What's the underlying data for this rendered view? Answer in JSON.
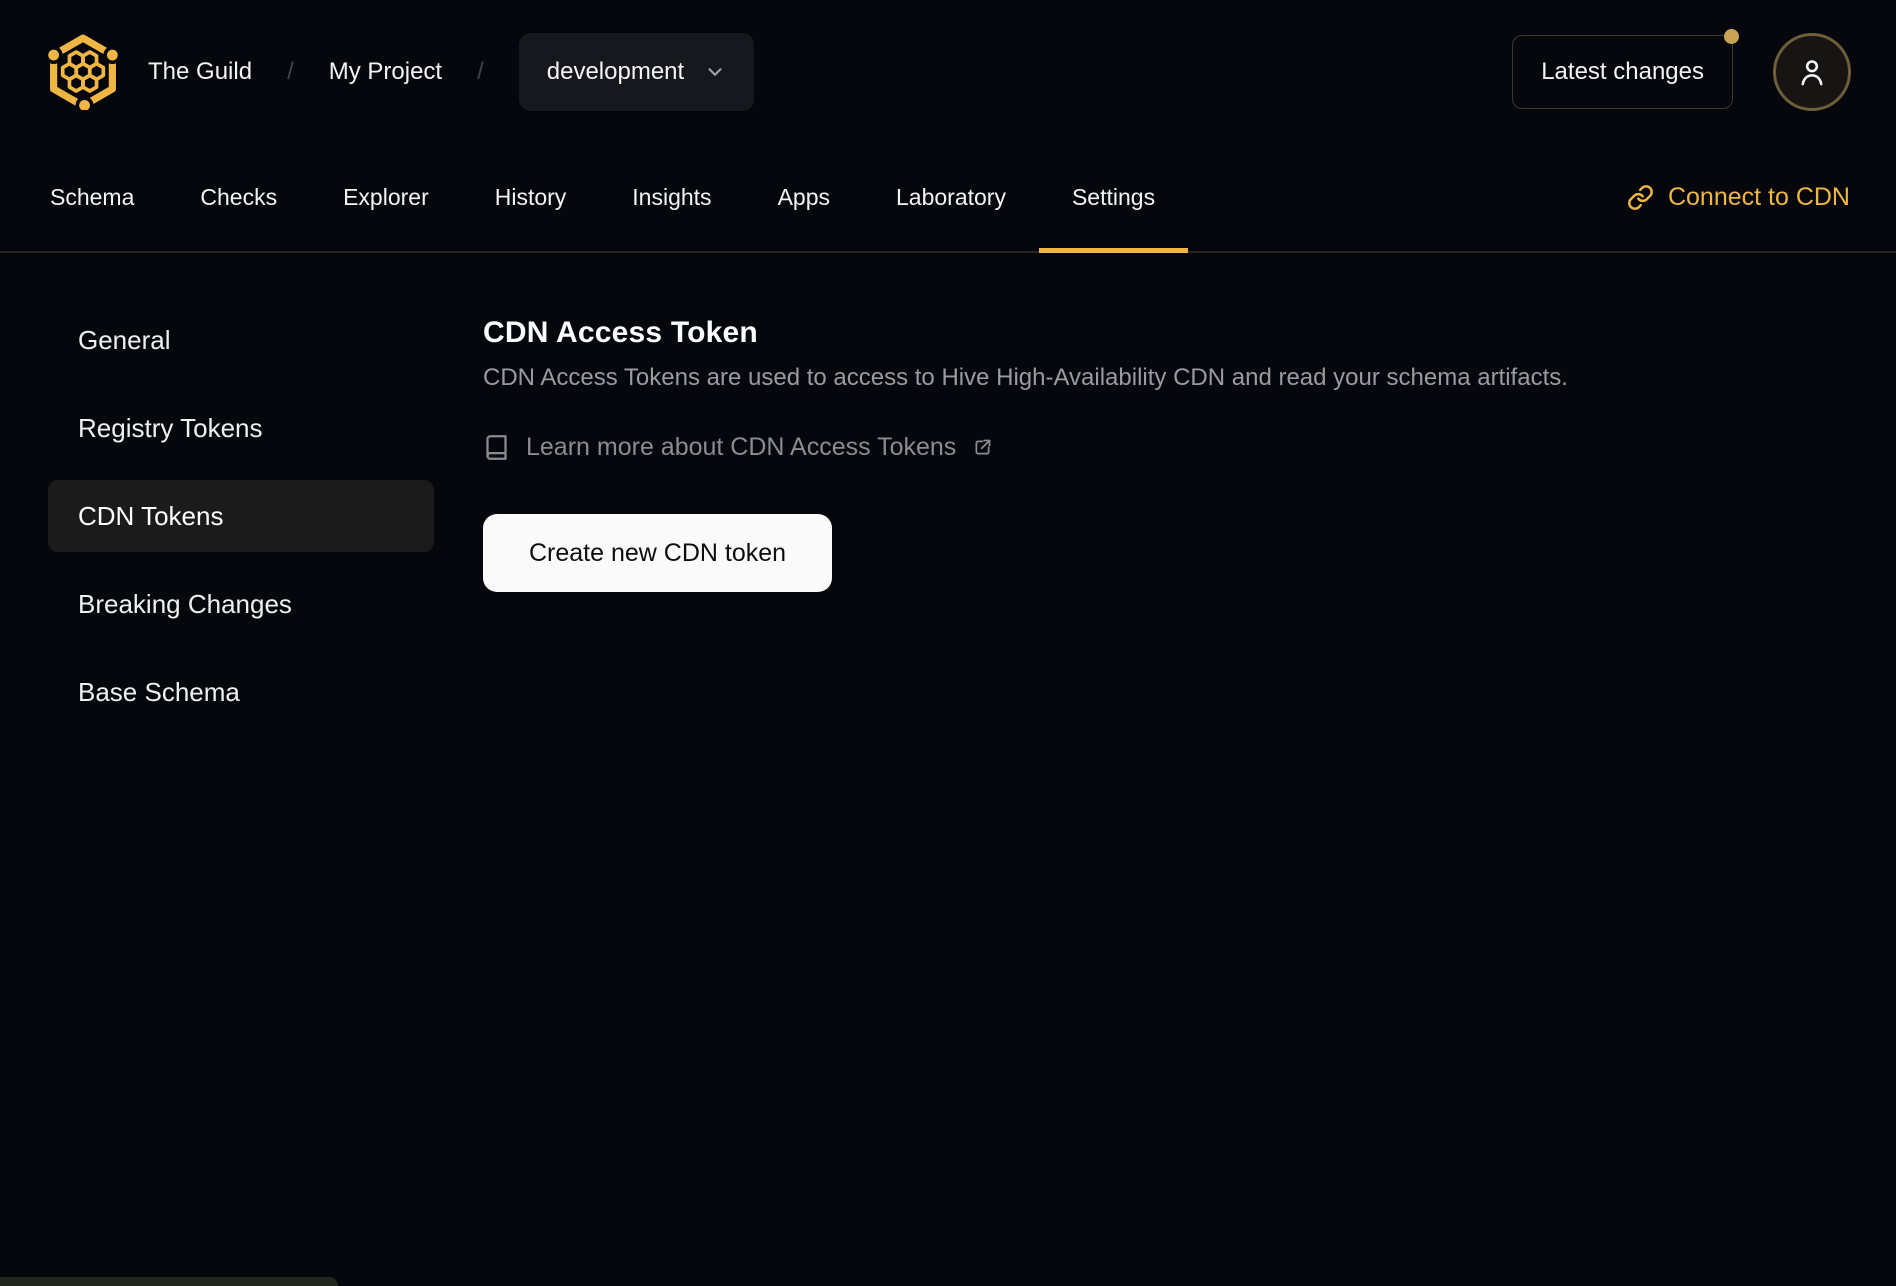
{
  "colors": {
    "bg": "#05070d",
    "surface": "#17181d",
    "surface_active": "#1b1b1b",
    "accent": "#efb644",
    "text": "#f3f4f6",
    "text_muted": "#9a9ba0",
    "text_dim": "#8b8c91",
    "separator": "#42454b",
    "border": "#26251f",
    "border_warm": "#3b382e",
    "button_bg": "#fafafa",
    "button_text": "#0b0d11",
    "avatar_border": "#6f5e3a",
    "dot": "#c9a355",
    "toast_bg": "#242620"
  },
  "header": {
    "logo_icon": "hive-honeycomb-logo",
    "breadcrumb": {
      "separator": "/",
      "items": [
        {
          "label": "The Guild"
        },
        {
          "label": "My Project"
        }
      ]
    },
    "target_selector": {
      "value": "development",
      "chevron_icon": "chevron-down"
    },
    "latest_changes_label": "Latest changes",
    "notification_dot": true,
    "avatar_icon": "user"
  },
  "tabs": {
    "items": [
      {
        "label": "Schema",
        "active": false
      },
      {
        "label": "Checks",
        "active": false
      },
      {
        "label": "Explorer",
        "active": false
      },
      {
        "label": "History",
        "active": false
      },
      {
        "label": "Insights",
        "active": false
      },
      {
        "label": "Apps",
        "active": false
      },
      {
        "label": "Laboratory",
        "active": false
      },
      {
        "label": "Settings",
        "active": true
      }
    ],
    "connect_cdn": {
      "label": "Connect to CDN",
      "icon": "link-chain"
    }
  },
  "sidebar": {
    "items": [
      {
        "label": "General",
        "active": false
      },
      {
        "label": "Registry Tokens",
        "active": false
      },
      {
        "label": "CDN Tokens",
        "active": true
      },
      {
        "label": "Breaking Changes",
        "active": false
      },
      {
        "label": "Base Schema",
        "active": false
      }
    ]
  },
  "main": {
    "title": "CDN Access Token",
    "description": "CDN Access Tokens are used to access to Hive High-Availability CDN and read your schema artifacts.",
    "learn_more": {
      "label": "Learn more about CDN Access Tokens",
      "leading_icon": "book",
      "trailing_icon": "external-link"
    },
    "create_button_label": "Create new CDN token"
  }
}
